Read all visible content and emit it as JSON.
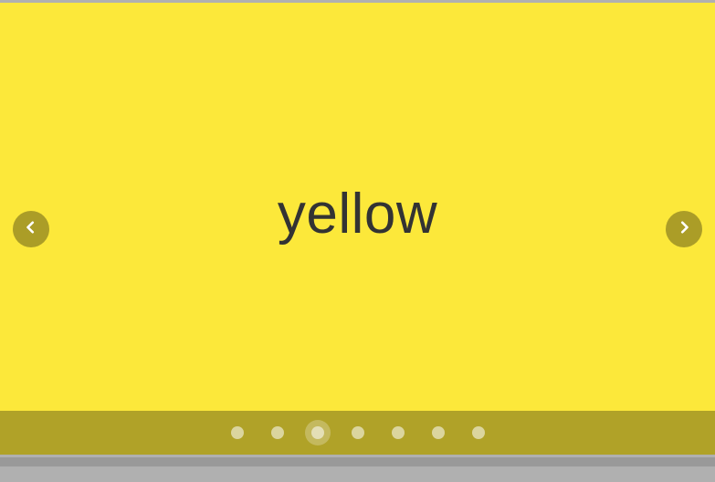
{
  "carousel": {
    "activeIndex": 2,
    "slides": [
      {
        "label": "",
        "bg": "#fce83a"
      },
      {
        "label": "",
        "bg": "#fce83a"
      },
      {
        "label": "yellow",
        "bg": "#fce83a"
      },
      {
        "label": "",
        "bg": "#fce83a"
      },
      {
        "label": "",
        "bg": "#fce83a"
      },
      {
        "label": "",
        "bg": "#fce83a"
      },
      {
        "label": "",
        "bg": "#fce83a"
      }
    ],
    "nav": {
      "prevIcon": "chevron-left",
      "nextIcon": "chevron-right"
    }
  }
}
